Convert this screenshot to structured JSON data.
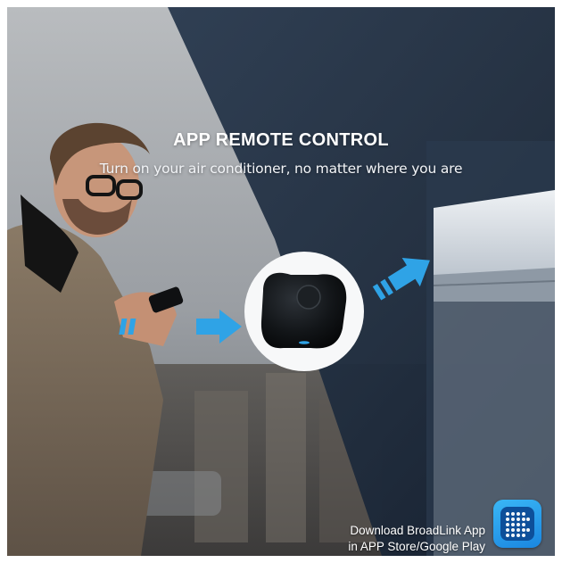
{
  "headline": {
    "title": "APP REMOTE CONTROL",
    "subtitle": "Turn on your air conditioner, no matter where you are"
  },
  "footer": {
    "download_line1": "Download BroadLink App",
    "download_line2": "in APP Store/Google Play"
  },
  "icons": {
    "arrow_left": "arrow-right-icon",
    "arrow_right": "arrow-up-right-icon",
    "app": "broadlink-app-icon"
  },
  "colors": {
    "accent_blue": "#2fa3e6",
    "dark_panel": "#1e2b3c",
    "device_body": "#111417"
  }
}
